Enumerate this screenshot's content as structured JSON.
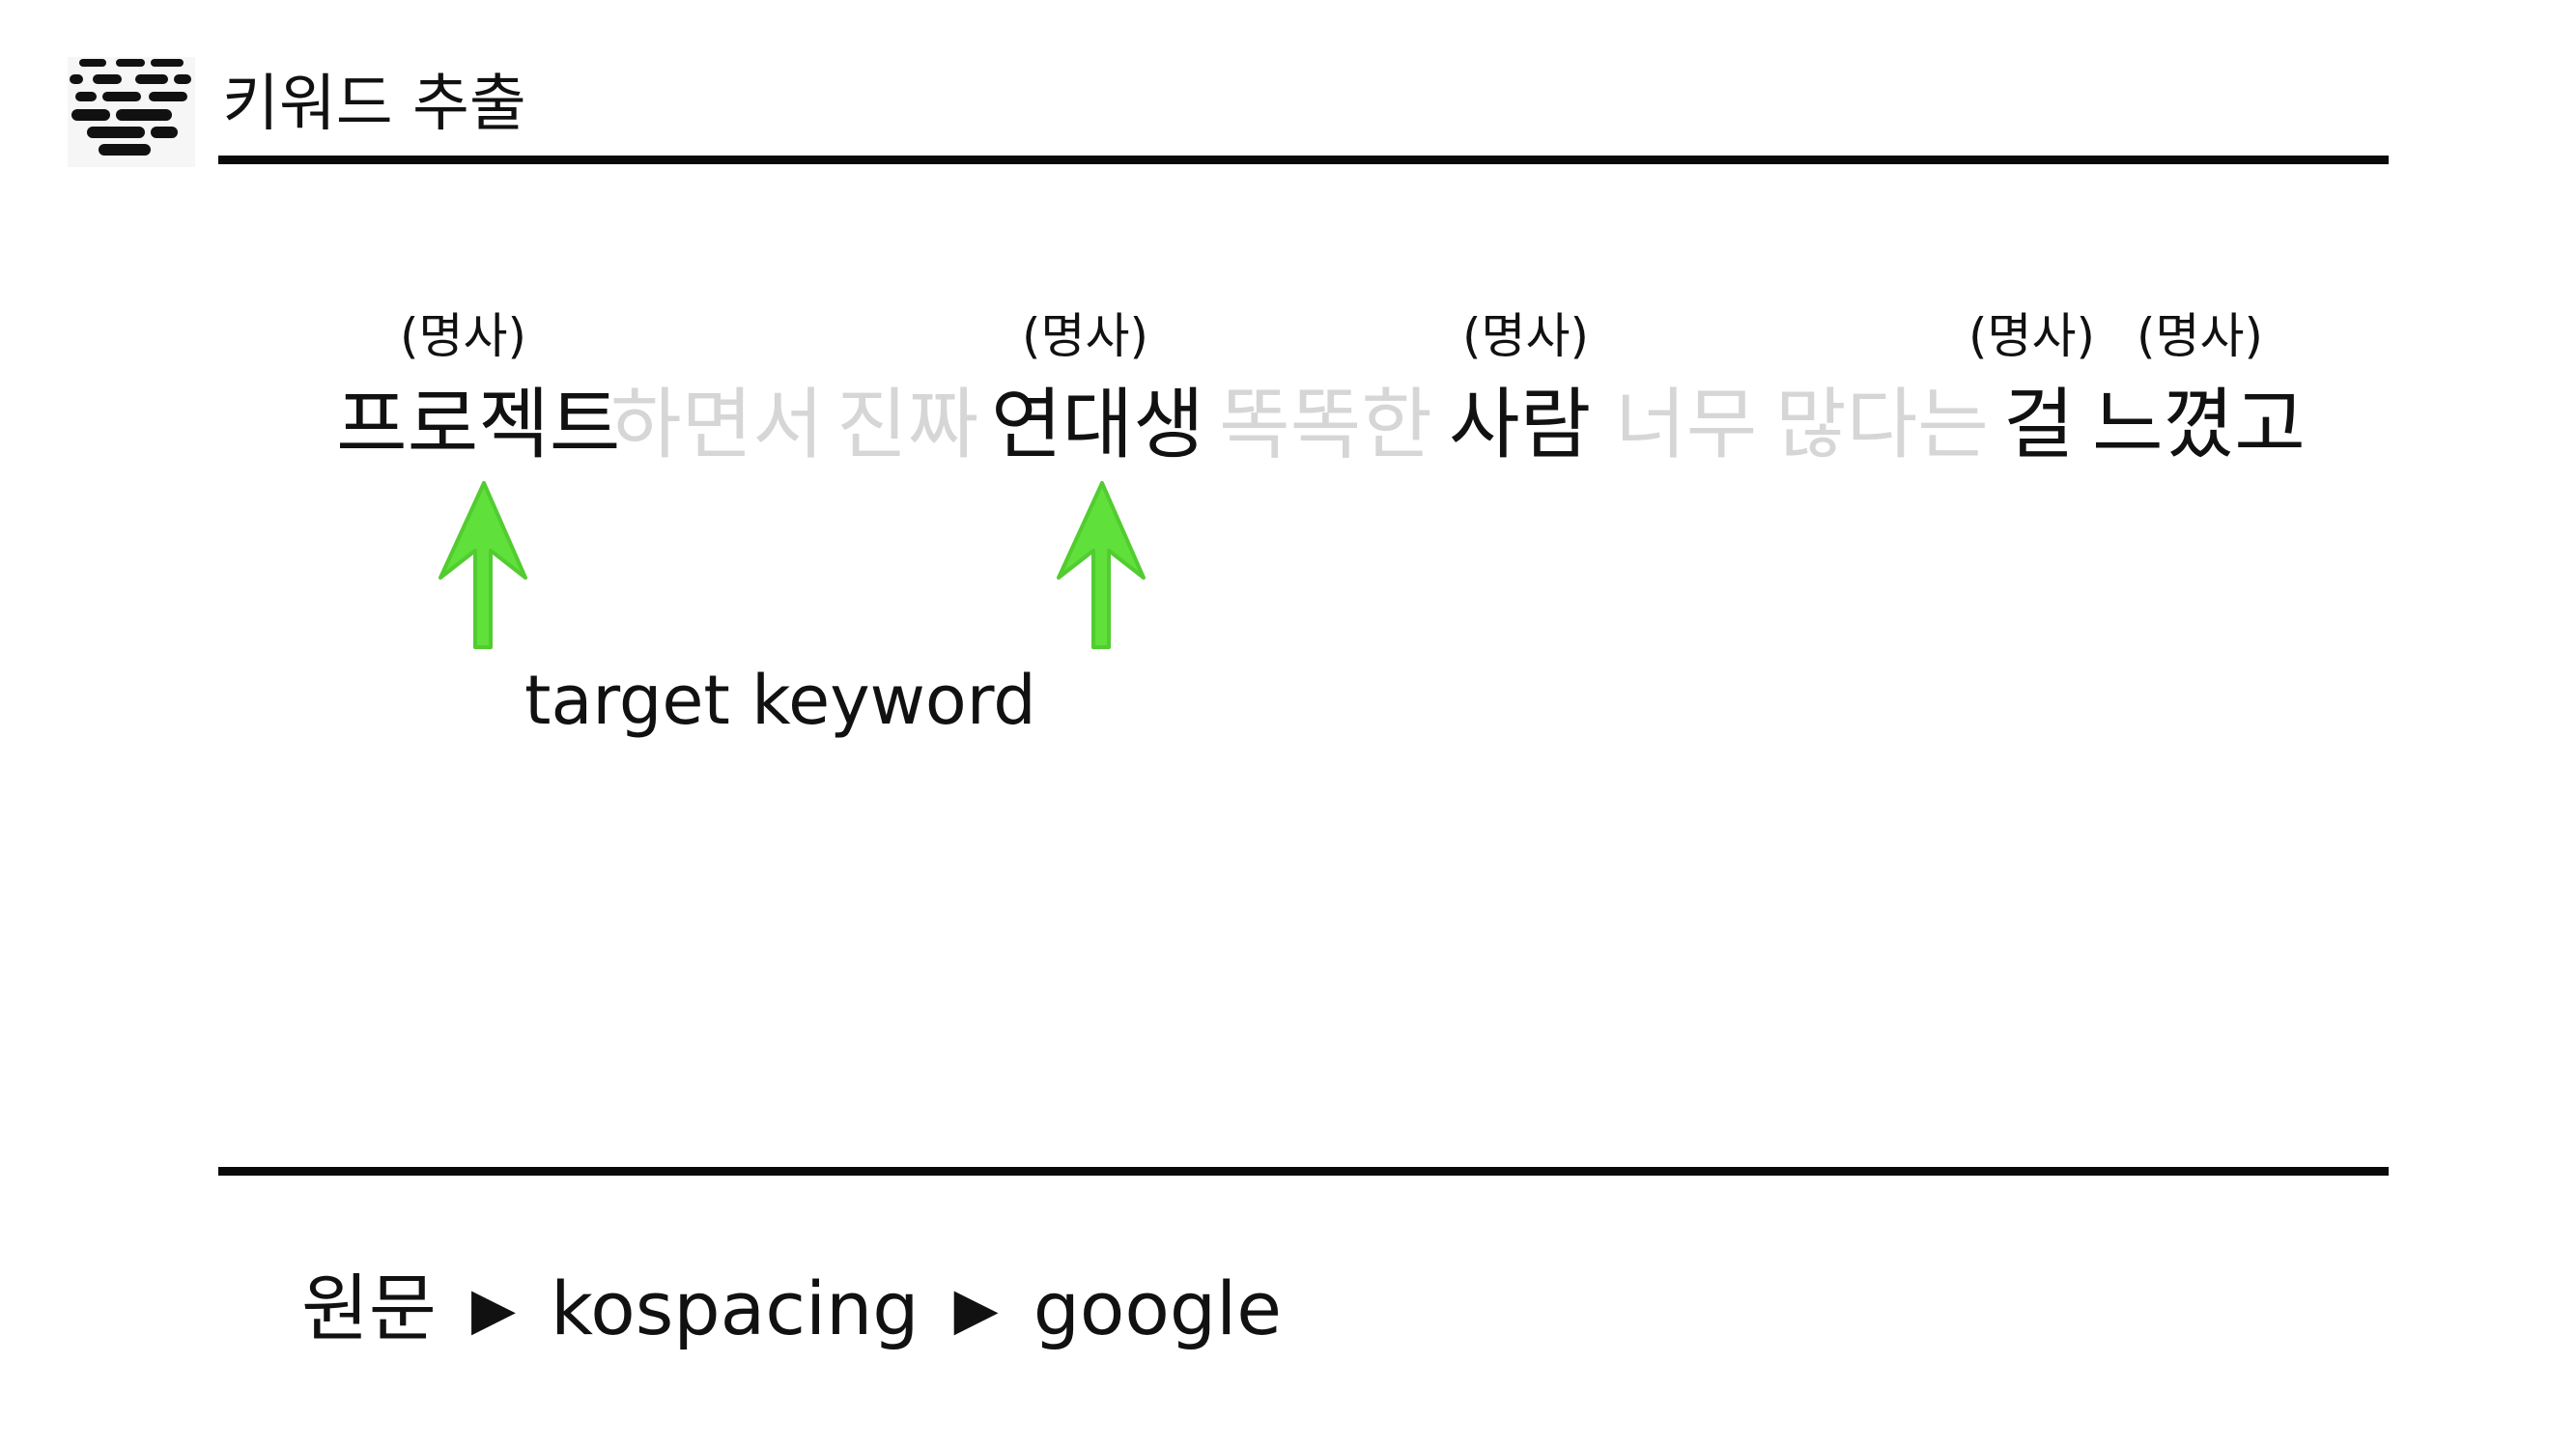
{
  "header": {
    "logo_icon": "menu-lines-icon",
    "title": "키워드 추출"
  },
  "sentence": {
    "tokens": [
      {
        "text": "프로젝트",
        "pos": "(명사)",
        "highlighted": true
      },
      {
        "text": "하면서",
        "pos": "",
        "highlighted": false
      },
      {
        "text": "진짜",
        "pos": "",
        "highlighted": false
      },
      {
        "text": "연대생",
        "pos": "(명사)",
        "highlighted": true
      },
      {
        "text": "똑똑한",
        "pos": "",
        "highlighted": false
      },
      {
        "text": "사람",
        "pos": "(명사)",
        "highlighted": true
      },
      {
        "text": "너무",
        "pos": "",
        "highlighted": false
      },
      {
        "text": "많다는",
        "pos": "",
        "highlighted": false
      },
      {
        "text": "걸",
        "pos": "(명사)",
        "highlighted": true
      },
      {
        "text": "느꼈고",
        "pos": "(명사)",
        "highlighted": true
      }
    ],
    "target_label": "target keyword",
    "arrow_icon": "green-up-arrow-icon",
    "colors": {
      "highlighted": "#111111",
      "dimmed": "#d6d6d6",
      "arrow": "#5fe03a"
    }
  },
  "pipeline": {
    "steps": [
      "원문",
      "kospacing",
      "google"
    ],
    "separator": "▶"
  }
}
